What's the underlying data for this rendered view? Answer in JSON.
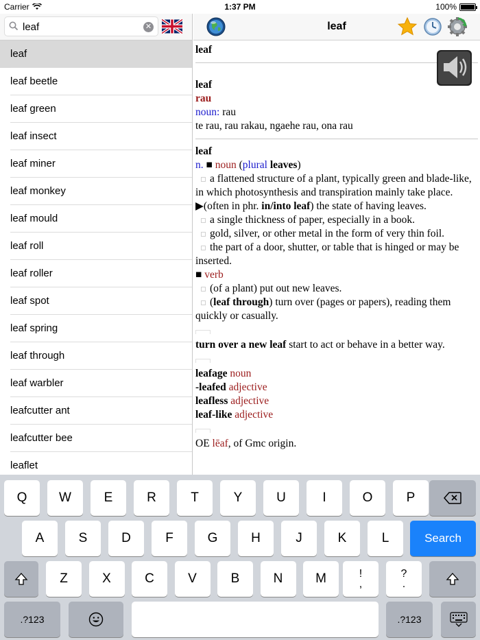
{
  "status": {
    "carrier": "Carrier",
    "time": "1:37 PM",
    "battery": "100%",
    "battery_level": 1.0
  },
  "search": {
    "value": "leaf",
    "placeholder": ""
  },
  "toolbar": {
    "title": "leaf"
  },
  "wordlist": [
    "leaf",
    "leaf beetle",
    "leaf green",
    "leaf insect",
    "leaf miner",
    "leaf monkey",
    "leaf mould",
    "leaf roll",
    "leaf roller",
    "leaf spot",
    "leaf spring",
    "leaf through",
    "leaf warbler",
    "leafcutter ant",
    "leafcutter bee",
    "leaflet"
  ],
  "selected_index": 0,
  "entry": {
    "header": "leaf",
    "block1": {
      "word": "leaf",
      "translation": "rau",
      "pos_label": "noun:",
      "pos_value": "rau",
      "phrases": "te rau, rau rakau, ngaehe rau, ona rau"
    },
    "block2": {
      "word": "leaf",
      "n": "n.",
      "pos": "noun",
      "plural_open": "(",
      "plural_label": "plural",
      "plural_word": "leaves",
      "plural_close": ")",
      "sense1a": "a flattened structure of a plant, typically green and blade-like, in which photosynthesis and transpiration mainly take place.",
      "sense1b_pre": "(often in phr.",
      "sense1b_bold": "in/into leaf",
      "sense1b_post": ") the state of having leaves.",
      "sense2": "a single thickness of paper, especially in a book.",
      "sense3": "gold, silver, or other metal in the form of very thin foil.",
      "sense4": "the part of a door, shutter, or table that is hinged or may be inserted.",
      "verb": "verb",
      "vsense1": "(of a plant) put out new leaves.",
      "vsense2_open": "(",
      "vsense2_bold": "leaf through",
      "vsense2_post": ") turn over (pages or papers), reading them quickly or casually."
    },
    "idiom": {
      "bold": "turn over a new leaf",
      "text": "start to act or behave in a better way."
    },
    "derived": [
      {
        "word": "leafage",
        "pos": "noun"
      },
      {
        "word": "-leafed",
        "pos": "adjective"
      },
      {
        "word": "leafless",
        "pos": "adjective"
      },
      {
        "word": "leaf-like",
        "pos": "adjective"
      }
    ],
    "origin": {
      "pre": "OE",
      "word": "lēaf",
      "post": ", of Gmc origin."
    }
  },
  "keyboard": {
    "row1": [
      "Q",
      "W",
      "E",
      "R",
      "T",
      "Y",
      "U",
      "I",
      "O",
      "P"
    ],
    "row2": [
      "A",
      "S",
      "D",
      "F",
      "G",
      "H",
      "J",
      "K",
      "L"
    ],
    "row3": [
      "Z",
      "X",
      "C",
      "V",
      "B",
      "N",
      "M"
    ],
    "exclaim": [
      "!",
      ","
    ],
    "question": [
      "?",
      "."
    ],
    "search": "Search",
    "numbers": ".?123"
  },
  "colors": {
    "accent": "#1a82fb",
    "headword_red": "#9b1b1b",
    "link_blue": "#1a1acc"
  }
}
